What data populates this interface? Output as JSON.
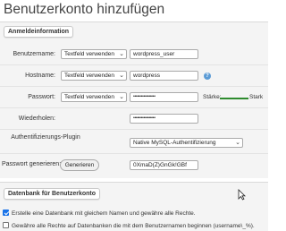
{
  "page_title": "Benutzerkonto hinzufügen",
  "login_info": {
    "legend": "Anmeldeinformation",
    "username": {
      "label": "Benutzername:",
      "mode": "Textfeld verwenden",
      "value": "wordpress_user"
    },
    "hostname": {
      "label": "Hostname:",
      "mode": "Textfeld verwenden",
      "value": "wordpress",
      "help_icon": "help-icon"
    },
    "password": {
      "label": "Passwort:",
      "mode": "Textfeld verwenden",
      "value_masked": "•••••••••••••••••",
      "strength_label": "Stärke:",
      "strength_value": "Stark",
      "strength_fraction": 1.0
    },
    "repeat": {
      "label": "Wiederholen:",
      "value_masked": "•••••••••••••••••"
    },
    "auth_plugin": {
      "label": "Authentifizierungs-Plugin",
      "value": "Native MySQL-Authentifizierung"
    },
    "generate": {
      "label": "Passwort generieren:",
      "button": "Generieren",
      "value": "0XmaD(Z)GnGk!GBf"
    }
  },
  "database": {
    "legend": "Datenbank für Benutzerkonto",
    "options": [
      {
        "label": "Erstelle eine Datenbank mit gleichem Namen und gewähre alle Rechte.",
        "checked": true
      },
      {
        "label": "Gewähre alle Rechte auf Datenbanken die mit dem Benutzernamen beginnen (username\\_%).",
        "checked": false
      }
    ]
  },
  "colors": {
    "accent": "#1a73e8",
    "strength": "#2e8b2e",
    "help": "#5b9bd5"
  }
}
